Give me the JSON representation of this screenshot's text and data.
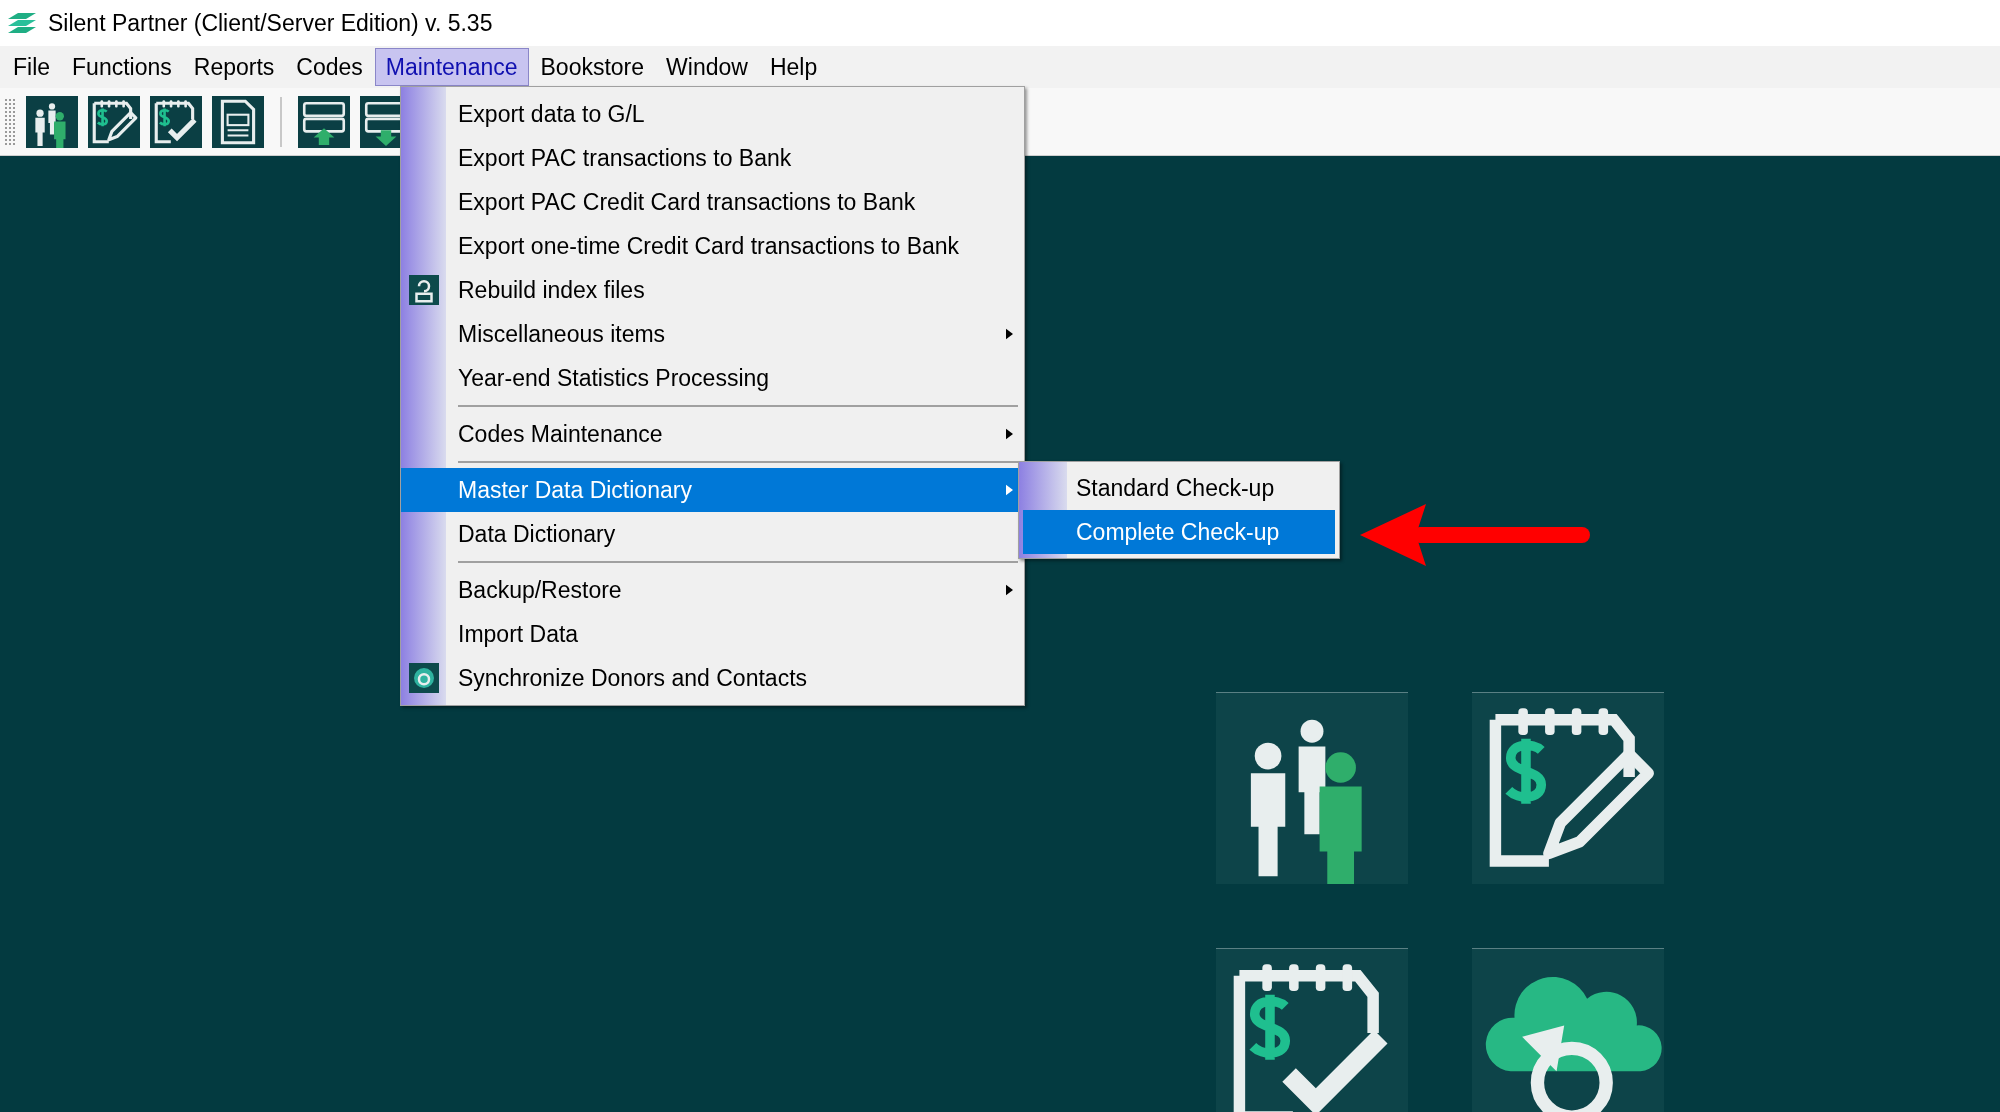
{
  "window": {
    "title": "Silent Partner (Client/Server Edition) v. 5.35"
  },
  "menu_bar": [
    {
      "label": "File",
      "selected": false
    },
    {
      "label": "Functions",
      "selected": false
    },
    {
      "label": "Reports",
      "selected": false
    },
    {
      "label": "Codes",
      "selected": false
    },
    {
      "label": "Maintenance",
      "selected": true
    },
    {
      "label": "Bookstore",
      "selected": false
    },
    {
      "label": "Window",
      "selected": false
    },
    {
      "label": "Help",
      "selected": false
    }
  ],
  "menu": [
    {
      "kind": "item",
      "label": "Export data to G/L",
      "selected": false,
      "submenu": false
    },
    {
      "kind": "item",
      "label": "Export PAC transactions to Bank",
      "selected": false,
      "submenu": false
    },
    {
      "kind": "item",
      "label": "Export PAC Credit Card transactions to Bank",
      "selected": false,
      "submenu": false
    },
    {
      "kind": "item",
      "label": "Export one-time Credit Card transactions to Bank",
      "selected": false,
      "submenu": false
    },
    {
      "kind": "icon_item",
      "label": "Rebuild index files",
      "selected": false,
      "submenu": false
    },
    {
      "kind": "item",
      "label": "Miscellaneous items",
      "selected": false,
      "submenu": true
    },
    {
      "kind": "item",
      "label": "Year-end Statistics Processing",
      "selected": false,
      "submenu": false
    },
    {
      "kind": "separator"
    },
    {
      "kind": "item",
      "label": "Codes Maintenance",
      "selected": false,
      "submenu": true
    },
    {
      "kind": "separator"
    },
    {
      "kind": "item",
      "label": "Master Data Dictionary",
      "selected": true,
      "submenu": true
    },
    {
      "kind": "item",
      "label": "Data Dictionary",
      "selected": false,
      "submenu": false
    },
    {
      "kind": "separator"
    },
    {
      "kind": "item",
      "label": "Backup/Restore",
      "selected": false,
      "submenu": true
    },
    {
      "kind": "item",
      "label": "Import Data",
      "selected": false,
      "submenu": false
    },
    {
      "kind": "icon_item",
      "label": "Synchronize Donors and Contacts",
      "selected": false,
      "submenu": false
    }
  ],
  "submenu": [
    {
      "label": "Standard Check-up",
      "selected": false
    },
    {
      "label": "Complete Check-up",
      "selected": true
    }
  ]
}
